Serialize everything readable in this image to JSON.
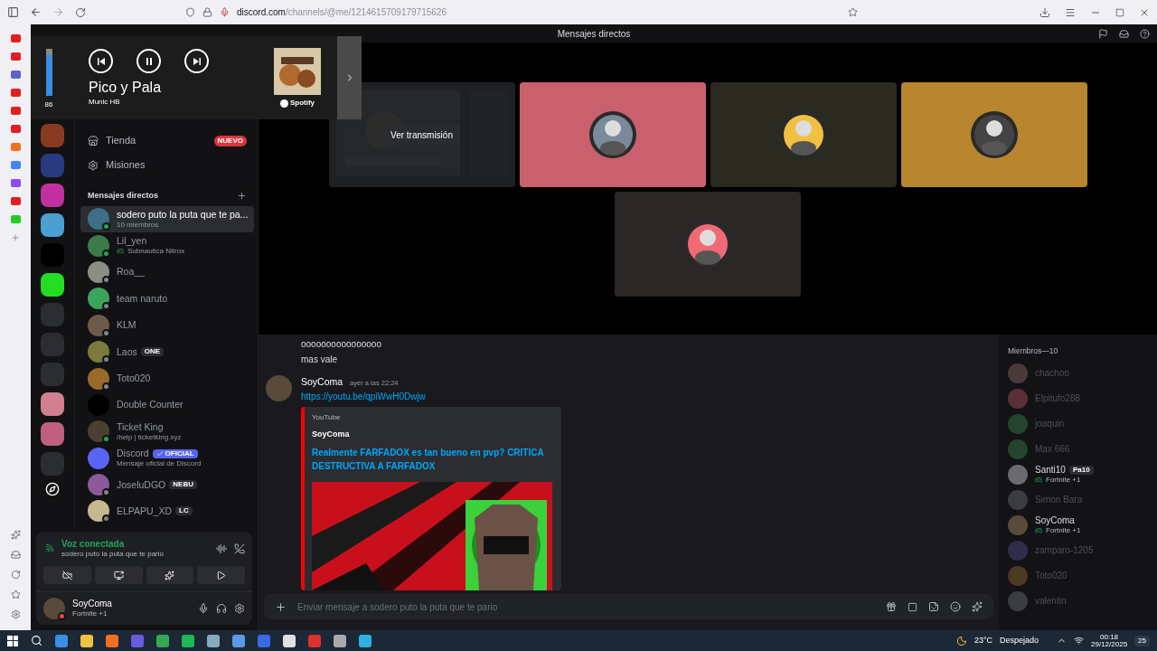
{
  "browser": {
    "host": "discord.com",
    "path": "/channels/@me/1214615709179715626"
  },
  "media": {
    "volume": "86",
    "level": 0.86,
    "title": "Pico y Pala",
    "artist": "Munic HB",
    "source": "Spotify"
  },
  "window": {
    "title": "Mensajes directos"
  },
  "nav": [
    {
      "label": "Tienda",
      "badge": "NUEVO"
    },
    {
      "label": "Misiones"
    }
  ],
  "dm_header": "Mensajes directos",
  "dms": [
    {
      "name": "sodero puto la puta que te pa...",
      "subtitle": "10 miembros",
      "selected": true,
      "online": true,
      "color": "#3d6f86"
    },
    {
      "name": "Lil_yen",
      "subtitle": "Subnautica Nitrox",
      "game": true,
      "selected": false,
      "online": true,
      "color": "#3c7a4a"
    },
    {
      "name": "Roa__",
      "selected": false,
      "online": false,
      "color": "#8a8f86"
    },
    {
      "name": "team naruto",
      "selected": false,
      "online": false,
      "color": "#3ba55c"
    },
    {
      "name": "KLM",
      "selected": false,
      "online": false,
      "color": "#6e5a4a"
    },
    {
      "name": "Laos",
      "tag": "ONE",
      "official": false,
      "selected": false,
      "online": false,
      "color": "#7a7a3a"
    },
    {
      "name": "Toto020",
      "selected": false,
      "online": false,
      "color": "#9a6a2a"
    },
    {
      "name": "Double Counter",
      "selected": false,
      "color": "#000000"
    },
    {
      "name": "Ticket King",
      "subtitle": "/help | ticketking.xyz",
      "selected": false,
      "online": true,
      "color": "#4a4030"
    },
    {
      "name": "Discord",
      "tag": "OFICIAL",
      "official": true,
      "subtitle": "Mensaje oficial de Discord",
      "selected": false,
      "color": "#5865f2"
    },
    {
      "name": "JoseluDGO",
      "tag": "NEBU",
      "official": false,
      "selected": false,
      "online": false,
      "color": "#8a5a9a"
    },
    {
      "name": "ELPAPU_XD",
      "tag": "LC",
      "official": false,
      "selected": false,
      "online": false,
      "color": "#c8b890"
    }
  ],
  "voice": {
    "status": "Voz conectada",
    "channel": "sodero puto la puta que te pario"
  },
  "user": {
    "name": "SoyComa",
    "activity": "Fortnite +1"
  },
  "call_tiles": [
    {
      "kind": "stream",
      "label": "Ver transmisión",
      "color": "#1e2022"
    },
    {
      "kind": "avatar",
      "color": "#c9606e"
    },
    {
      "kind": "avatar",
      "color": "#2b2a21"
    },
    {
      "kind": "avatar",
      "color": "#b8862f"
    },
    {
      "kind": "avatar",
      "color": "#2a2726"
    }
  ],
  "messages": [
    {
      "kind": "line",
      "text": "oooooooooooooooo"
    },
    {
      "kind": "line",
      "text": "mas vale"
    },
    {
      "kind": "post",
      "author": "SoyComa",
      "time": "ayer a las 22:24",
      "link": "https://youtu.be/qpiWwH0Dwjw",
      "embed": {
        "provider": "YouTube",
        "author": "SoyComa",
        "title": "Realmente FARFADOX es tan bueno en pvp? CRITICA DESTRUCTIVA A FARFADOX"
      }
    }
  ],
  "input": {
    "placeholder": "Enviar mensaje a sodero puto la puta que te pario"
  },
  "members": {
    "header": "Miembros—10",
    "list": [
      {
        "name": "chachoo",
        "online": false,
        "color": "#4a3a38"
      },
      {
        "name": "Elpitufo288",
        "online": false,
        "color": "#5a3036"
      },
      {
        "name": "joaquin",
        "online": false,
        "color": "#23452d"
      },
      {
        "name": "Max 666",
        "online": false,
        "color": "#23452d"
      },
      {
        "name": "Santi10",
        "online": true,
        "activity": "Fortnite +1",
        "tag": "Pa10",
        "color": "#6a6a70"
      },
      {
        "name": "Simon Bara",
        "online": false,
        "color": "#3a3c40"
      },
      {
        "name": "SoyComa",
        "online": true,
        "activity": "Fortnite +1",
        "color": "#5a4a3a"
      },
      {
        "name": "zamparo-1205",
        "online": false,
        "color": "#2e2e4a"
      },
      {
        "name": "Toto020",
        "online": false,
        "color": "#4a3a20"
      },
      {
        "name": "valentin",
        "online": false,
        "color": "#3a3e42"
      }
    ]
  },
  "taskbar": {
    "temperature": "23°C",
    "weather": "Despejado",
    "time": "00:18",
    "date": "29/12/2025",
    "notifications": "25"
  }
}
